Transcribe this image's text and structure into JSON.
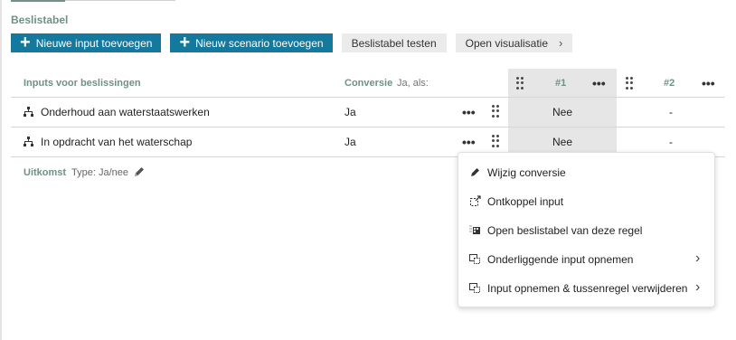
{
  "title": "Beslistabel",
  "toolbar": {
    "add_input_label": "Nieuwe input toevoegen",
    "add_scenario_label": "Nieuw scenario toevoegen",
    "test_label": "Beslistabel testen",
    "visualisation_label": "Open visualisatie",
    "plus_glyph": "+",
    "chevron_glyph": "›"
  },
  "table": {
    "headers": {
      "inputs": "Inputs voor beslissingen",
      "conversion": "Conversie",
      "conversion_sub": "Ja, als:",
      "scenario1": "#1",
      "scenario2": "#2"
    },
    "rows": [
      {
        "name": "Onderhoud aan waterstaatswerken",
        "conversion": "Ja",
        "s1": "Nee",
        "s2": "-"
      },
      {
        "name": "In opdracht van het waterschap",
        "conversion": "Ja",
        "s1": "Nee",
        "s2": "-"
      }
    ],
    "more_glyph": "•••"
  },
  "outcome": {
    "label": "Uitkomst",
    "type": "Type: Ja/nee"
  },
  "context_menu": {
    "items": [
      {
        "label": "Wijzig conversie",
        "icon": "pencil-icon",
        "submenu": false
      },
      {
        "label": "Ontkoppel input",
        "icon": "unlink-icon",
        "submenu": false
      },
      {
        "label": "Open beslistabel van deze regel",
        "icon": "table-icon",
        "submenu": false
      },
      {
        "label": "Onderliggende input opnemen",
        "icon": "include-input-icon",
        "submenu": true
      },
      {
        "label": "Input opnemen & tussenregel verwijderen",
        "icon": "include-input-icon",
        "submenu": true
      }
    ],
    "submenu_glyph": "›"
  },
  "colors": {
    "accent": "#6f9186",
    "primary_button": "#15789d",
    "secondary_button": "#ebebeb",
    "column_highlight": "#e6e6e6"
  }
}
